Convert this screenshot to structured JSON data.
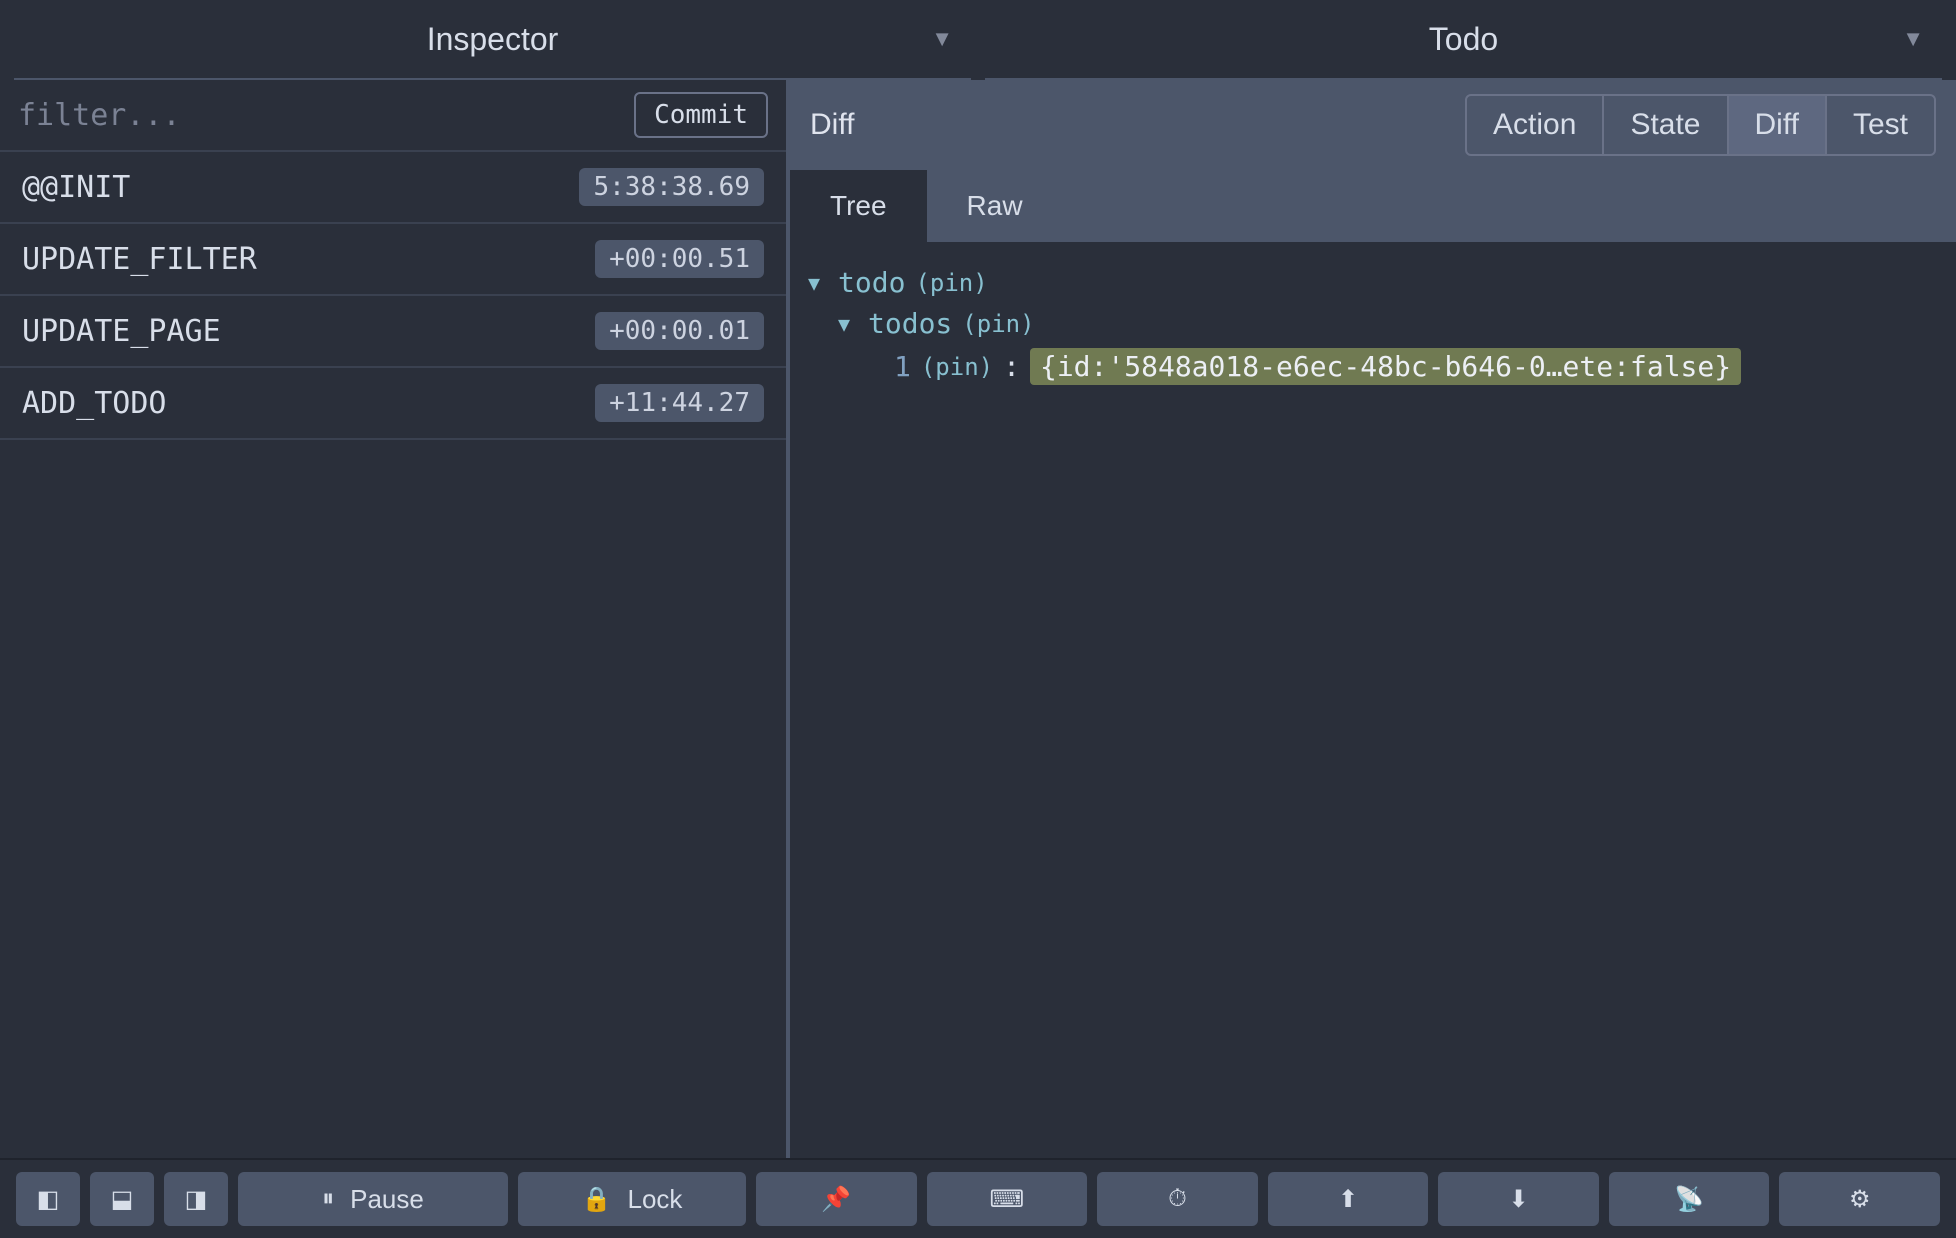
{
  "header": {
    "left_label": "Inspector",
    "right_label": "Todo"
  },
  "filter": {
    "placeholder": "filter...",
    "value": "",
    "commit_label": "Commit"
  },
  "actions": [
    {
      "name": "@@INIT",
      "time": "5:38:38.69"
    },
    {
      "name": "UPDATE_FILTER",
      "time": "+00:00.51"
    },
    {
      "name": "UPDATE_PAGE",
      "time": "+00:00.01"
    },
    {
      "name": "ADD_TODO",
      "time": "+11:44.27"
    }
  ],
  "right": {
    "title": "Diff",
    "view_tabs": [
      "Action",
      "State",
      "Diff",
      "Test"
    ],
    "view_active": "Diff",
    "sub_tabs": [
      "Tree",
      "Raw"
    ],
    "sub_active": "Tree"
  },
  "tree": {
    "root_key": "todo",
    "root_pin": "(pin)",
    "child_key": "todos",
    "child_pin": "(pin)",
    "leaf_index": "1",
    "leaf_pin": "(pin)",
    "leaf_colon": ":",
    "leaf_value": "{id:'5848a018-e6ec-48bc-b646-0…ete:false}"
  },
  "bottom": {
    "pause": "Pause",
    "lock": "Lock"
  }
}
